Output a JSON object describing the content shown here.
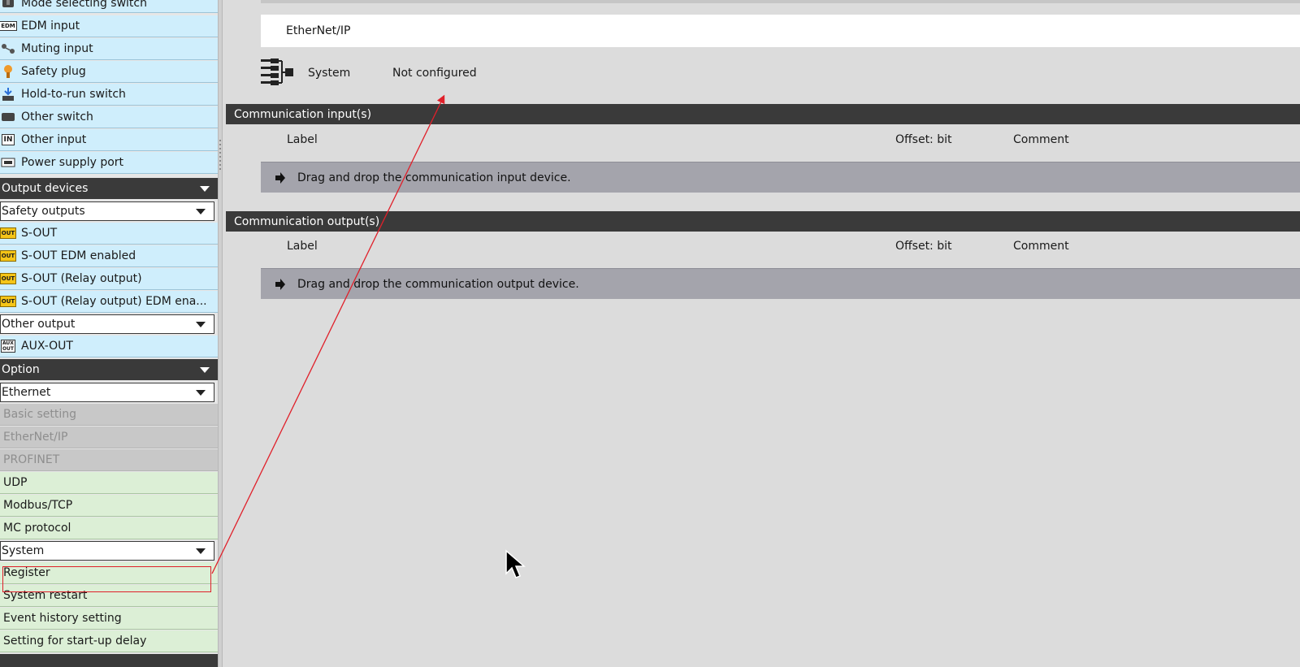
{
  "left_panel": {
    "input_items": [
      {
        "label": "Mode selecting switch",
        "icon": "selector-switch-icon"
      },
      {
        "label": "EDM input",
        "icon": "edm-icon",
        "icon_text": "EDM"
      },
      {
        "label": "Muting input",
        "icon": "muting-sensor-icon"
      },
      {
        "label": "Safety plug",
        "icon": "safety-plug-icon"
      },
      {
        "label": "Hold-to-run switch",
        "icon": "hold-to-run-icon"
      },
      {
        "label": "Other switch",
        "icon": "switch-icon"
      },
      {
        "label": "Other input",
        "icon": "other-input-icon",
        "icon_text": "IN"
      },
      {
        "label": "Power supply port",
        "icon": "power-port-icon"
      }
    ],
    "output_header": "Output devices",
    "safety_outputs_dropdown": "Safety outputs",
    "safety_output_items": [
      {
        "label": "S-OUT",
        "icon_text": "OUT"
      },
      {
        "label": "S-OUT EDM enabled",
        "icon_text": "OUT"
      },
      {
        "label": "S-OUT (Relay output)",
        "icon_text": "OUT"
      },
      {
        "label": "S-OUT (Relay output) EDM ena...",
        "icon_text": "OUT"
      }
    ],
    "other_output_dropdown": "Other output",
    "aux_item": {
      "label": "AUX-OUT",
      "icon_text_top": "AUX",
      "icon_text_bottom": "OUT"
    },
    "option_header": "Option",
    "ethernet_dropdown": "Ethernet",
    "ethernet_disabled_items": [
      "Basic setting",
      "EtherNet/IP",
      "PROFINET"
    ],
    "ethernet_items": [
      "UDP",
      "Modbus/TCP",
      "MC protocol"
    ],
    "system_dropdown": "System",
    "system_items": [
      "Register",
      "System restart",
      "Event history setting",
      "Setting for start-up delay"
    ]
  },
  "main": {
    "ethernet_title": "EtherNet/IP",
    "system_label": "System",
    "system_status": "Not configured",
    "comm_input": {
      "header": "Communication input(s)",
      "col_label": "Label",
      "col_offset": "Offset: bit",
      "col_comment": "Comment",
      "drop_text": "Drag and drop the communication input device."
    },
    "comm_output": {
      "header": "Communication output(s)",
      "col_label": "Label",
      "col_offset": "Offset: bit",
      "col_comment": "Comment",
      "drop_text": "Drag and drop the communication output device."
    }
  },
  "colors": {
    "blue_item": "#cfeefc",
    "green_item": "#dcefd6",
    "header_dark": "#3a3a3a",
    "annotation_red": "#e0202a",
    "out_icon_yellow": "#f5c518"
  }
}
